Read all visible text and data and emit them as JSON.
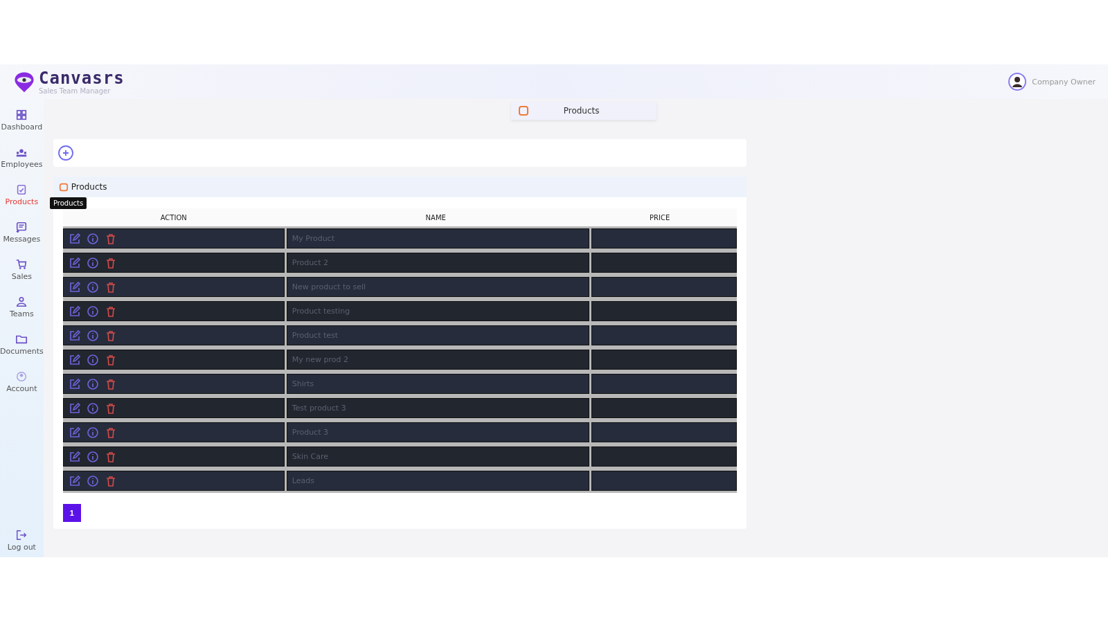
{
  "brand": {
    "name": "Canvasrs",
    "tagline": "Sales Team Manager"
  },
  "user": {
    "name": "Company Owner"
  },
  "sidebar": {
    "items": [
      {
        "label": "Dashboard",
        "selected": false
      },
      {
        "label": "Employees",
        "selected": false
      },
      {
        "label": "Products",
        "selected": true
      },
      {
        "label": "Messages",
        "selected": false
      },
      {
        "label": "Sales",
        "selected": false
      },
      {
        "label": "Teams",
        "selected": false
      },
      {
        "label": "Documents",
        "selected": false
      },
      {
        "label": "Account",
        "selected": false
      }
    ],
    "logout": "Log out",
    "tooltip": "Products"
  },
  "page_tab": {
    "label": "Products"
  },
  "panel": {
    "title": "Products",
    "columns": [
      "ACTION",
      "NAME",
      "PRICE"
    ],
    "rows": [
      {
        "name": "My Product"
      },
      {
        "name": "Product 2"
      },
      {
        "name": "New product to sell"
      },
      {
        "name": "Product testing"
      },
      {
        "name": "Product test"
      },
      {
        "name": "My new prod 2"
      },
      {
        "name": "Shirts"
      },
      {
        "name": "Test product 3"
      },
      {
        "name": "Product 3"
      },
      {
        "name": "Skin Care"
      },
      {
        "name": "Leads"
      }
    ],
    "pages": [
      {
        "label": "1",
        "selected": true
      }
    ]
  }
}
